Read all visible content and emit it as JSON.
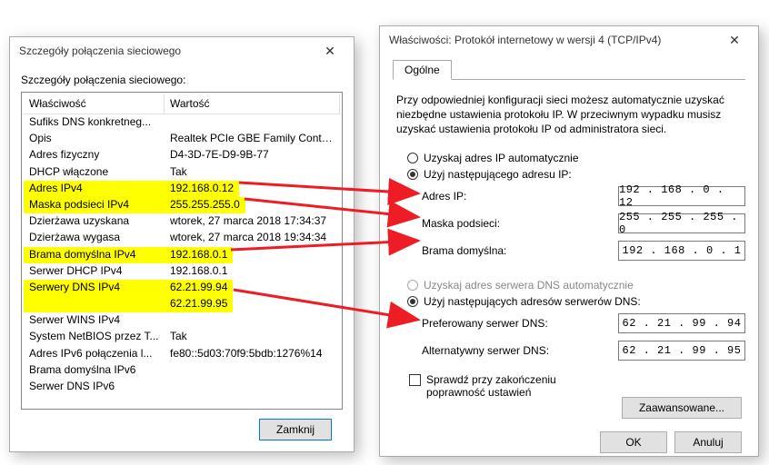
{
  "win1": {
    "title": "Szczegóły połączenia sieciowego",
    "subtitle": "Szczegóły połączenia sieciowego:",
    "col_prop": "Właściwość",
    "col_val": "Wartość",
    "close": "Zamknij",
    "rows": [
      {
        "p": "Sufiks DNS konkretneg...",
        "v": ""
      },
      {
        "p": "Opis",
        "v": "Realtek PCIe GBE Family Controller"
      },
      {
        "p": "Adres fizyczny",
        "v": "D4-3D-7E-D9-9B-77"
      },
      {
        "p": "DHCP włączone",
        "v": "Tak"
      },
      {
        "p": "Adres IPv4",
        "v": "192.168.0.12",
        "hl": true
      },
      {
        "p": "Maska podsieci IPv4",
        "v": "255.255.255.0",
        "hl": true
      },
      {
        "p": "Dzierżawa uzyskana",
        "v": "wtorek, 27 marca 2018 17:34:37"
      },
      {
        "p": "Dzierżawa wygasa",
        "v": "wtorek, 27 marca 2018 19:34:34"
      },
      {
        "p": "Brama domyślna IPv4",
        "v": "192.168.0.1",
        "hl": true
      },
      {
        "p": "Serwer DHCP IPv4",
        "v": "192.168.0.1"
      },
      {
        "p": "Serwery DNS IPv4",
        "v": "62.21.99.94",
        "hl": true
      },
      {
        "p": "",
        "v": "62.21.99.95",
        "hl": true
      },
      {
        "p": "Serwer WINS IPv4",
        "v": ""
      },
      {
        "p": "System NetBIOS przez T...",
        "v": "Tak"
      },
      {
        "p": "Adres IPv6 połączenia l...",
        "v": "fe80::5d03:70f9:5bdb:1276%14"
      },
      {
        "p": "Brama domyślna IPv6",
        "v": ""
      },
      {
        "p": "Serwer DNS IPv6",
        "v": ""
      }
    ]
  },
  "win2": {
    "title": "Właściwości: Protokół internetowy w wersji 4 (TCP/IPv4)",
    "tab": "Ogólne",
    "desc": "Przy odpowiedniej konfiguracji sieci możesz automatycznie uzyskać niezbędne ustawienia protokołu IP. W przeciwnym wypadku musisz uzyskać ustawienia protokołu IP od administratora sieci.",
    "r_ip_auto": "Uzyskaj adres IP automatycznie",
    "r_ip_man": "Użyj następującego adresu IP:",
    "f_ip": "Adres IP:",
    "f_mask": "Maska podsieci:",
    "f_gw": "Brama domyślna:",
    "v_ip": "192 . 168 .  0  .  12",
    "v_mask": "255 . 255 . 255 .  0",
    "v_gw": "192 . 168 .  0  .   1",
    "r_dns_auto": "Uzyskaj adres serwera DNS automatycznie",
    "r_dns_man": "Użyj następujących adresów serwerów DNS:",
    "f_dns1": "Preferowany serwer DNS:",
    "f_dns2": "Alternatywny serwer DNS:",
    "v_dns1": "62  .  21  .  99  .  94",
    "v_dns2": "62  .  21  .  99  .  95",
    "chk": "Sprawdź przy zakończeniu poprawność ustawień",
    "adv": "Zaawansowane...",
    "ok": "OK",
    "cancel": "Anuluj"
  }
}
